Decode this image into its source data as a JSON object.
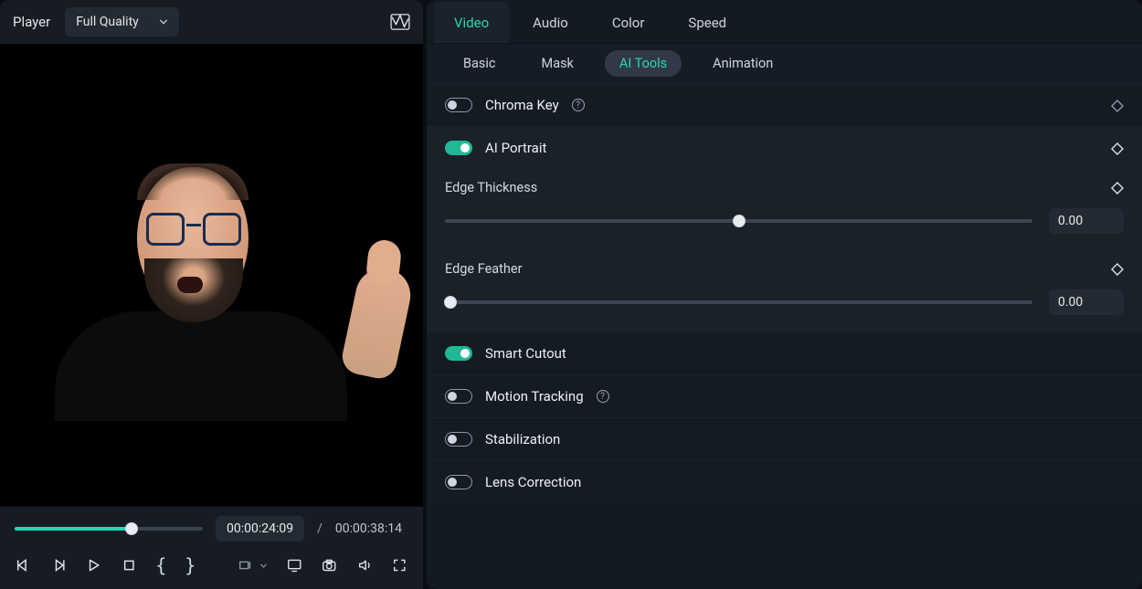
{
  "player": {
    "label": "Player",
    "quality": "Full Quality",
    "currentTime": "00:00:24:09",
    "separator": "/",
    "duration": "00:00:38:14",
    "progressPercent": 62
  },
  "mainTabs": [
    {
      "label": "Video",
      "active": true
    },
    {
      "label": "Audio",
      "active": false
    },
    {
      "label": "Color",
      "active": false
    },
    {
      "label": "Speed",
      "active": false
    }
  ],
  "subTabs": [
    {
      "label": "Basic",
      "active": false
    },
    {
      "label": "Mask",
      "active": false
    },
    {
      "label": "AI Tools",
      "active": true
    },
    {
      "label": "Animation",
      "active": false
    }
  ],
  "rows": {
    "chromaKey": {
      "label": "Chroma Key",
      "on": false,
      "help": true
    },
    "aiPortrait": {
      "label": "AI Portrait",
      "on": true,
      "help": false
    },
    "smartCutout": {
      "label": "Smart Cutout",
      "on": true,
      "help": false
    },
    "motionTracking": {
      "label": "Motion Tracking",
      "on": false,
      "help": true
    },
    "stabilization": {
      "label": "Stabilization",
      "on": false,
      "help": false
    },
    "lensCorrection": {
      "label": "Lens Correction",
      "on": false,
      "help": false
    }
  },
  "params": {
    "edgeThickness": {
      "label": "Edge Thickness",
      "value": "0.00",
      "percent": 50
    },
    "edgeFeather": {
      "label": "Edge Feather",
      "value": "0.00",
      "percent": 0
    }
  },
  "helpGlyph": "?"
}
